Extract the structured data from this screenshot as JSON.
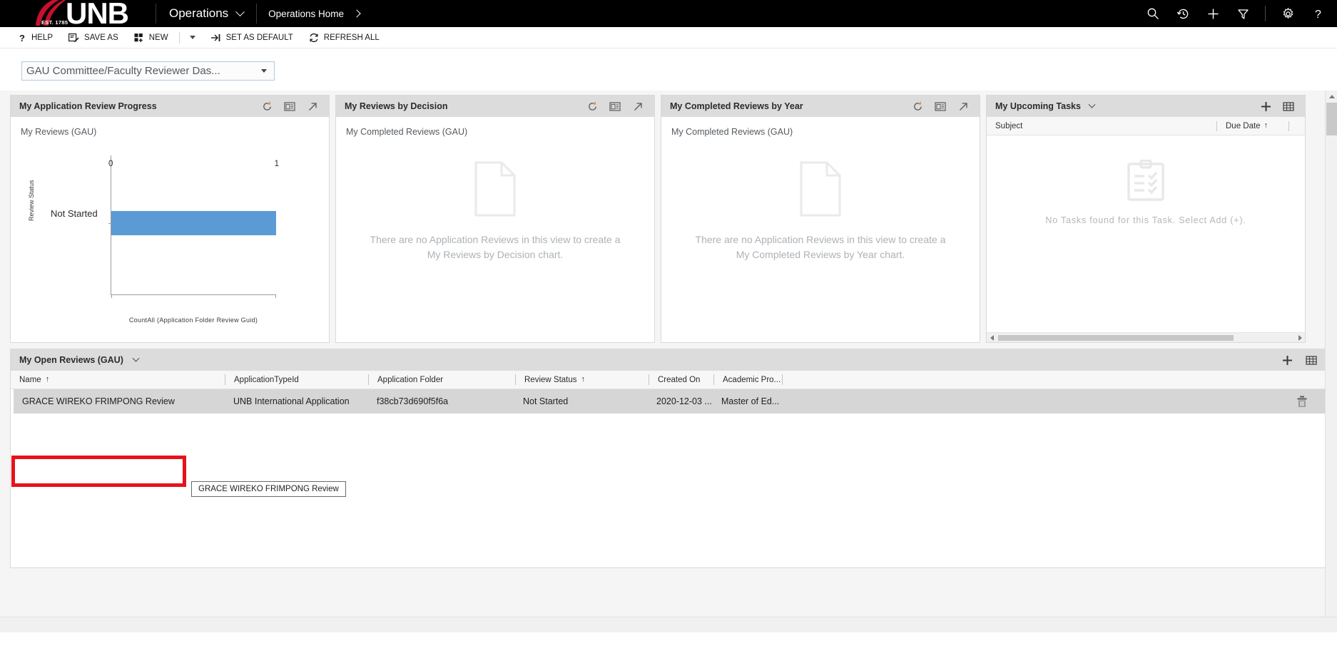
{
  "topnav": {
    "brand": "UNB",
    "brand_est": "EST. 1785",
    "app_name": "Operations",
    "breadcrumb": "Operations Home",
    "icons": [
      {
        "name": "search-icon",
        "label": "Search"
      },
      {
        "name": "history-icon",
        "label": "Recently Viewed"
      },
      {
        "name": "quick-create-icon",
        "label": "Quick Create"
      },
      {
        "name": "filter-icon",
        "label": "Advanced Find"
      },
      {
        "name": "gear-icon",
        "label": "Settings"
      },
      {
        "name": "help-icon",
        "label": "Help"
      }
    ]
  },
  "commandbar": {
    "items": [
      {
        "name": "help-command",
        "label": "HELP",
        "icon": "question-icon"
      },
      {
        "name": "save-as-command",
        "label": "SAVE AS",
        "icon": "save-as-icon"
      },
      {
        "name": "new-command",
        "label": "NEW",
        "icon": "new-icon"
      },
      {
        "name": "set-as-default-command",
        "label": "SET AS DEFAULT",
        "icon": "pin-icon"
      },
      {
        "name": "refresh-all-command",
        "label": "REFRESH ALL",
        "icon": "refresh-icon"
      }
    ]
  },
  "view_selector": {
    "value": "GAU Committee/Faculty Reviewer Das..."
  },
  "panels": {
    "review_progress": {
      "title": "My Application Review Progress",
      "subtitle": "My Reviews (GAU)"
    },
    "reviews_by_decision": {
      "title": "My Reviews by Decision",
      "subtitle": "My Completed Reviews (GAU)",
      "empty_message": "There are no Application Reviews in this view to create a My Reviews by Decision chart."
    },
    "completed_by_year": {
      "title": "My Completed Reviews by Year",
      "subtitle": "My Completed Reviews (GAU)",
      "empty_message": "There are no Application Reviews in this view to create a My Completed Reviews by Year chart."
    },
    "upcoming_tasks": {
      "title": "My Upcoming Tasks",
      "columns": [
        "Subject",
        "Due Date"
      ],
      "sort_indicator": "↑",
      "empty_message": "No Tasks found for this Task. Select Add (+)."
    }
  },
  "chart_data": {
    "type": "bar",
    "title": "My Reviews (GAU)",
    "orientation": "horizontal",
    "categories": [
      "Not Started"
    ],
    "values": [
      1
    ],
    "xlabel": "CountAll (Application Folder Review Guid)",
    "ylabel": "Review Status",
    "xticks": [
      "0",
      "1"
    ],
    "xlim": [
      0,
      1
    ],
    "grid": false,
    "legend": "none",
    "bar_color": "#5b9bd5"
  },
  "grid": {
    "title": "My Open Reviews (GAU)",
    "columns": [
      {
        "label": "Name",
        "sorted": true,
        "sort_indicator": "↑"
      },
      {
        "label": "ApplicationTypeId",
        "sorted": false,
        "sort_indicator": ""
      },
      {
        "label": "Application Folder",
        "sorted": false,
        "sort_indicator": ""
      },
      {
        "label": "Review Status",
        "sorted": true,
        "sort_indicator": "↑"
      },
      {
        "label": "Created On",
        "sorted": false,
        "sort_indicator": ""
      },
      {
        "label": "Academic Pro...",
        "sorted": false,
        "sort_indicator": ""
      }
    ],
    "rows": [
      {
        "name": "GRACE WIREKO FRIMPONG Review",
        "application_type_id": "UNB International Application",
        "application_folder": "f38cb73d690f5f6a",
        "review_status": "Not Started",
        "created_on": "2020-12-03 ...",
        "academic_program": "Master of Ed..."
      }
    ],
    "tooltip": "GRACE WIREKO FRIMPONG Review"
  },
  "colors": {
    "brand_red": "#c8102e",
    "nav_black": "#000000",
    "bar_blue": "#5b9bd5",
    "highlight_red": "#e8111b",
    "panel_header": "#dcdcdc"
  }
}
